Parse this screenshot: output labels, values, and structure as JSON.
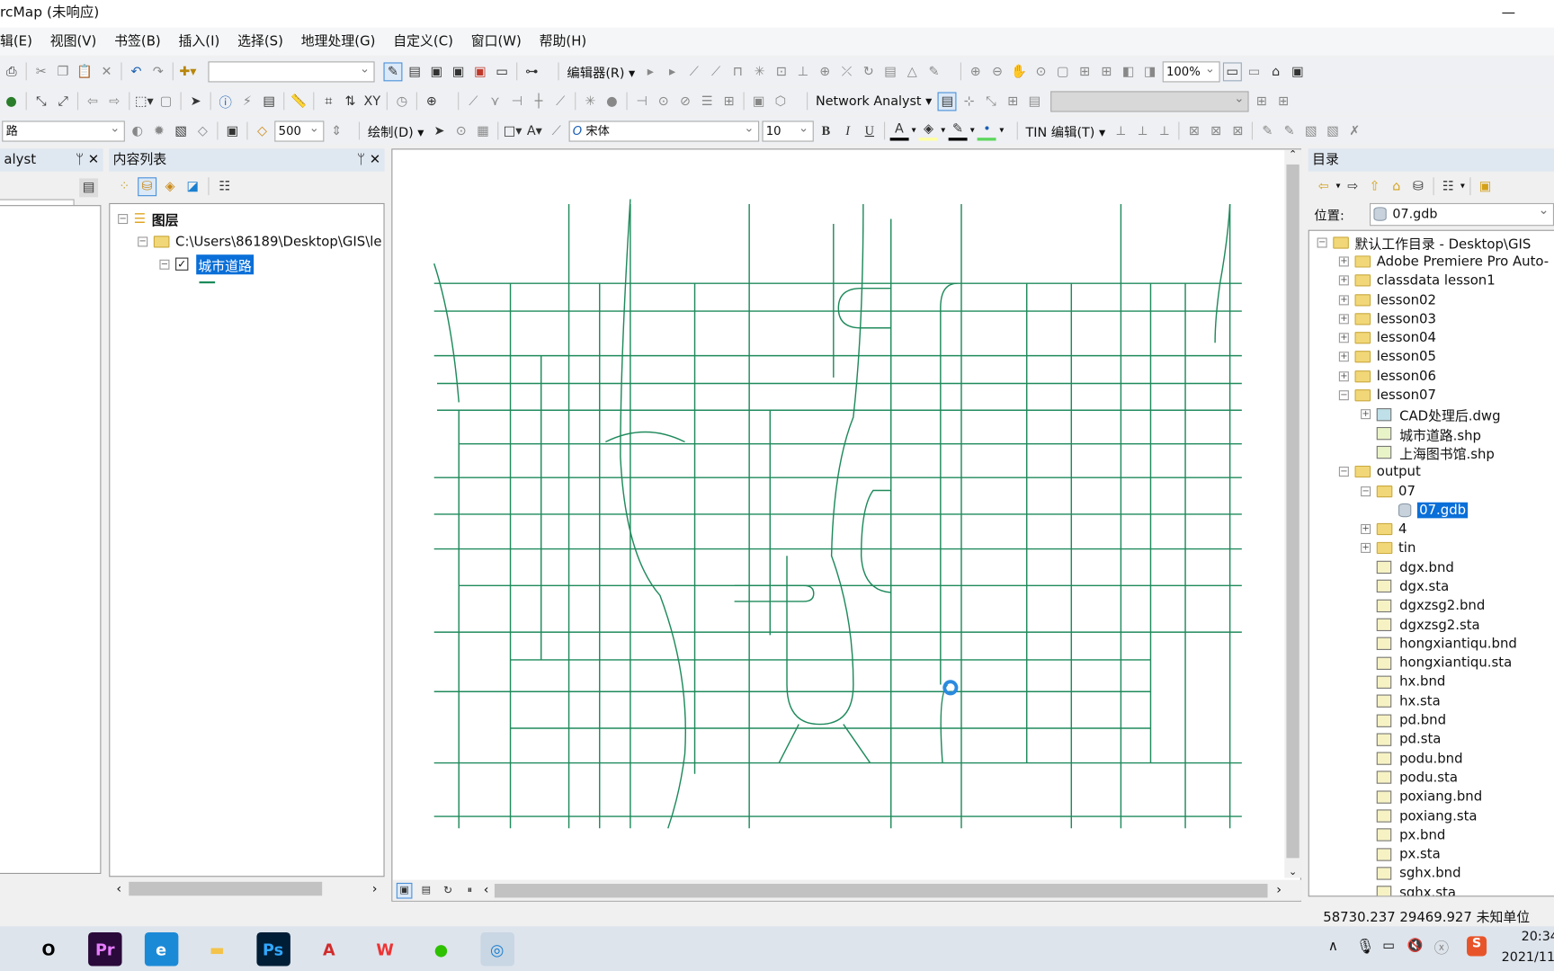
{
  "window": {
    "title": "rcMap (未响应)",
    "minimize": "—"
  },
  "menu": [
    "辑(E)",
    "视图(V)",
    "书签(B)",
    "插入(I)",
    "选择(S)",
    "地理处理(G)",
    "自定义(C)",
    "窗口(W)",
    "帮助(H)"
  ],
  "toolbar": {
    "scale_value": "500",
    "editor_label": "编辑器(R)",
    "zoom_value": "100%",
    "network_analyst_label": "Network Analyst",
    "draw_label": "绘制(D)",
    "font_name": "宋体",
    "font_size": "10",
    "bold": "B",
    "italic": "I",
    "underline": "U",
    "tin_label": "TIN 编辑(T)",
    "layer_combo": "路"
  },
  "left_panel": {
    "title": "alyst"
  },
  "toc": {
    "title": "内容列表",
    "layers_root": "图层",
    "path": "C:\\Users\\86189\\Desktop\\GIS\\le",
    "layer": "城市道路",
    "checked": true,
    "line_color": "#1a8a5a"
  },
  "map": {
    "road_color": "#1f8a5c"
  },
  "catalog": {
    "title": "目录",
    "location_label": "位置:",
    "location_value": "07.gdb",
    "items": [
      {
        "label": "默认工作目录 - Desktop\\GIS",
        "level": 0,
        "exp": "−",
        "icon": "home-folder"
      },
      {
        "label": "Adobe Premiere Pro Auto-",
        "level": 1,
        "exp": "+",
        "icon": "folder"
      },
      {
        "label": "classdata lesson1",
        "level": 1,
        "exp": "+",
        "icon": "folder"
      },
      {
        "label": "lesson02",
        "level": 1,
        "exp": "+",
        "icon": "folder"
      },
      {
        "label": "lesson03",
        "level": 1,
        "exp": "+",
        "icon": "folder"
      },
      {
        "label": "lesson04",
        "level": 1,
        "exp": "+",
        "icon": "folder"
      },
      {
        "label": "lesson05",
        "level": 1,
        "exp": "+",
        "icon": "folder"
      },
      {
        "label": "lesson06",
        "level": 1,
        "exp": "+",
        "icon": "folder"
      },
      {
        "label": "lesson07",
        "level": 1,
        "exp": "−",
        "icon": "folder"
      },
      {
        "label": "CAD处理后.dwg",
        "level": 2,
        "exp": "+",
        "icon": "cad"
      },
      {
        "label": "城市道路.shp",
        "level": 2,
        "exp": "",
        "icon": "line-shp"
      },
      {
        "label": "上海图书馆.shp",
        "level": 2,
        "exp": "",
        "icon": "point-shp"
      },
      {
        "label": "output",
        "level": 1,
        "exp": "−",
        "icon": "folder"
      },
      {
        "label": "07",
        "level": 2,
        "exp": "−",
        "icon": "folder"
      },
      {
        "label": "07.gdb",
        "level": 3,
        "exp": "",
        "icon": "gdb",
        "selected": true
      },
      {
        "label": "4",
        "level": 2,
        "exp": "+",
        "icon": "folder"
      },
      {
        "label": "tin",
        "level": 2,
        "exp": "+",
        "icon": "folder"
      },
      {
        "label": "dgx.bnd",
        "level": 2,
        "exp": "",
        "icon": "table"
      },
      {
        "label": "dgx.sta",
        "level": 2,
        "exp": "",
        "icon": "table"
      },
      {
        "label": "dgxzsg2.bnd",
        "level": 2,
        "exp": "",
        "icon": "table"
      },
      {
        "label": "dgxzsg2.sta",
        "level": 2,
        "exp": "",
        "icon": "table"
      },
      {
        "label": "hongxiantiqu.bnd",
        "level": 2,
        "exp": "",
        "icon": "table"
      },
      {
        "label": "hongxiantiqu.sta",
        "level": 2,
        "exp": "",
        "icon": "table"
      },
      {
        "label": "hx.bnd",
        "level": 2,
        "exp": "",
        "icon": "table"
      },
      {
        "label": "hx.sta",
        "level": 2,
        "exp": "",
        "icon": "table"
      },
      {
        "label": "pd.bnd",
        "level": 2,
        "exp": "",
        "icon": "table"
      },
      {
        "label": "pd.sta",
        "level": 2,
        "exp": "",
        "icon": "table"
      },
      {
        "label": "podu.bnd",
        "level": 2,
        "exp": "",
        "icon": "table"
      },
      {
        "label": "podu.sta",
        "level": 2,
        "exp": "",
        "icon": "table"
      },
      {
        "label": "poxiang.bnd",
        "level": 2,
        "exp": "",
        "icon": "table"
      },
      {
        "label": "poxiang.sta",
        "level": 2,
        "exp": "",
        "icon": "table"
      },
      {
        "label": "px.bnd",
        "level": 2,
        "exp": "",
        "icon": "table"
      },
      {
        "label": "px.sta",
        "level": 2,
        "exp": "",
        "icon": "table"
      },
      {
        "label": "sghx.bnd",
        "level": 2,
        "exp": "",
        "icon": "table"
      },
      {
        "label": "sghx.sta",
        "level": 2,
        "exp": "",
        "icon": "table"
      }
    ]
  },
  "status": {
    "coords": "58730.237  29469.927 未知单位"
  },
  "taskbar": {
    "apps": [
      {
        "name": "cortana",
        "glyph": "O",
        "color": "#000",
        "bg": "transparent"
      },
      {
        "name": "premiere",
        "glyph": "Pr",
        "color": "#e77cff",
        "bg": "#2a0a3a"
      },
      {
        "name": "edge",
        "glyph": "e",
        "color": "#fff",
        "bg": "#1b8ad6"
      },
      {
        "name": "explorer",
        "glyph": "▬",
        "color": "#f3c34a",
        "bg": "transparent"
      },
      {
        "name": "photoshop",
        "glyph": "Ps",
        "color": "#31a8ff",
        "bg": "#001e36"
      },
      {
        "name": "autocad",
        "glyph": "A",
        "color": "#d12b2b",
        "bg": "transparent"
      },
      {
        "name": "wps",
        "glyph": "W",
        "color": "#e33",
        "bg": "transparent"
      },
      {
        "name": "wechat",
        "glyph": "●",
        "color": "#2dc100",
        "bg": "transparent"
      },
      {
        "name": "arcmap",
        "glyph": "◎",
        "color": "#1a7fd0",
        "bg": "#c9d6e3"
      }
    ],
    "time": "20:34",
    "date": "2021/11"
  }
}
